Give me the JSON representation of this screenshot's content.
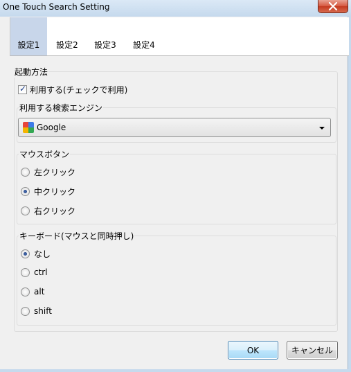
{
  "window": {
    "title": "One Touch Search Setting",
    "close_label": "×"
  },
  "tabs": [
    "設定1",
    "設定2",
    "設定3",
    "設定4"
  ],
  "active_tab_index": 0,
  "startup": {
    "group_title": "起動方法",
    "use_checkbox_label": "利用する(チェックで利用)",
    "use_checked": true
  },
  "engine": {
    "group_title": "利用する検索エンジン",
    "selected": "Google",
    "icon": "google-favicon"
  },
  "mouse": {
    "group_title": "マウスボタン",
    "options": [
      "左クリック",
      "中クリック",
      "右クリック"
    ],
    "selected_index": 1
  },
  "keyboard": {
    "group_title": "キーボード(マウスと同時押し)",
    "options": [
      "なし",
      "ctrl",
      "alt",
      "shift"
    ],
    "selected_index": 0
  },
  "buttons": {
    "ok": "OK",
    "cancel": "キャンセル"
  },
  "colors": {
    "active_tab": "#c8d6ea",
    "frame": "#c6daed",
    "radio_dot": "#1b3a78"
  }
}
